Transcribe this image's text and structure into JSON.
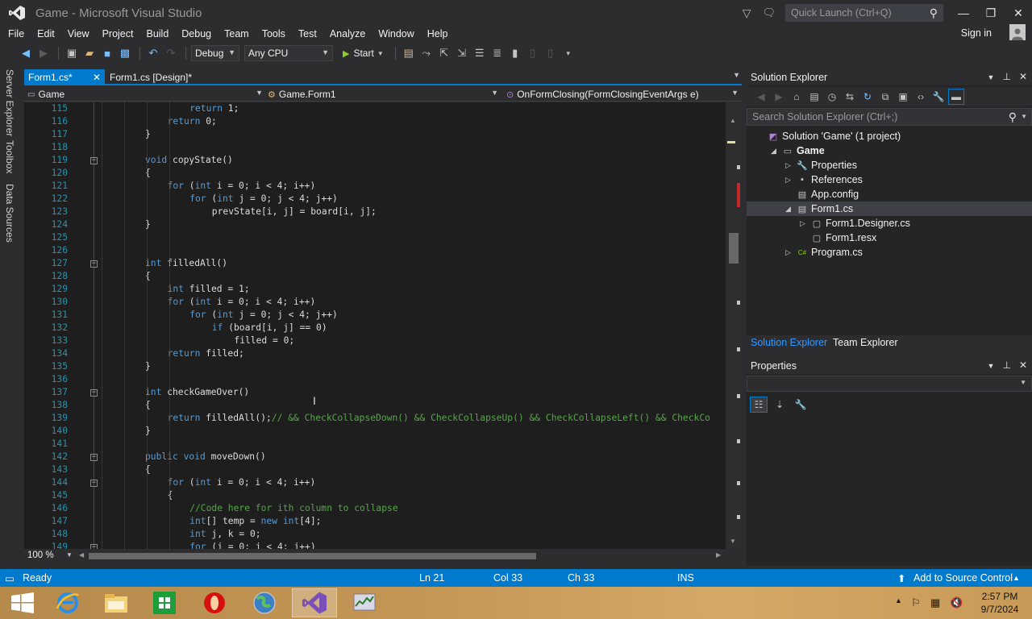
{
  "window": {
    "title": "Game - Microsoft Visual Studio",
    "quick_launch_placeholder": "Quick Launch (Ctrl+Q)",
    "sign_in": "Sign in"
  },
  "menu": [
    "File",
    "Edit",
    "View",
    "Project",
    "Build",
    "Debug",
    "Team",
    "Tools",
    "Test",
    "Analyze",
    "Window",
    "Help"
  ],
  "toolbar": {
    "config": "Debug",
    "platform": "Any CPU",
    "start_label": "Start"
  },
  "side_tabs": [
    "Server Explorer",
    "Toolbox",
    "Data Sources"
  ],
  "doc_tabs": {
    "active": "Form1.cs*",
    "inactive": "Form1.cs [Design]*"
  },
  "nav": {
    "project": "Game",
    "class": "Game.Form1",
    "member": "OnFormClosing(FormClosingEventArgs e)"
  },
  "code_lines": [
    {
      "n": "115",
      "indent": 3,
      "code": "<span class='kw'>return</span> 1;"
    },
    {
      "n": "116",
      "indent": 2,
      "code": "<span class='kw'>return</span> 0;"
    },
    {
      "n": "117",
      "indent": 1,
      "code": "}"
    },
    {
      "n": "118",
      "indent": 0,
      "code": ""
    },
    {
      "n": "119",
      "indent": 1,
      "fold": true,
      "code": "<span class='kw'>void</span> copyState()"
    },
    {
      "n": "120",
      "indent": 1,
      "code": "{"
    },
    {
      "n": "121",
      "indent": 2,
      "code": "<span class='kw'>for</span> (<span class='kw'>int</span> i = 0; i &lt; 4; i++)"
    },
    {
      "n": "122",
      "indent": 3,
      "code": "<span class='kw'>for</span> (<span class='kw'>int</span> j = 0; j &lt; 4; j++)"
    },
    {
      "n": "123",
      "indent": 4,
      "code": "prevState[i, j] = board[i, j];"
    },
    {
      "n": "124",
      "indent": 1,
      "code": "}"
    },
    {
      "n": "125",
      "indent": 0,
      "code": ""
    },
    {
      "n": "126",
      "indent": 0,
      "code": ""
    },
    {
      "n": "127",
      "indent": 1,
      "fold": true,
      "code": "<span class='kw'>int</span> filledAll()"
    },
    {
      "n": "128",
      "indent": 1,
      "code": "{"
    },
    {
      "n": "129",
      "indent": 2,
      "code": "<span class='kw'>int</span> filled = 1;"
    },
    {
      "n": "130",
      "indent": 2,
      "code": "<span class='kw'>for</span> (<span class='kw'>int</span> i = 0; i &lt; 4; i++)"
    },
    {
      "n": "131",
      "indent": 3,
      "code": "<span class='kw'>for</span> (<span class='kw'>int</span> j = 0; j &lt; 4; j++)"
    },
    {
      "n": "132",
      "indent": 4,
      "code": "<span class='kw'>if</span> (board[i, j] == 0)"
    },
    {
      "n": "133",
      "indent": 5,
      "code": "filled = 0;"
    },
    {
      "n": "134",
      "indent": 2,
      "code": "<span class='kw'>return</span> filled;"
    },
    {
      "n": "135",
      "indent": 1,
      "code": "}"
    },
    {
      "n": "136",
      "indent": 0,
      "code": ""
    },
    {
      "n": "137",
      "indent": 1,
      "fold": true,
      "code": "<span class='kw'>int</span> checkGameOver()"
    },
    {
      "n": "138",
      "indent": 1,
      "code": "{"
    },
    {
      "n": "139",
      "indent": 2,
      "code": "<span class='kw'>return</span> filledAll();<span class='cm'>// &amp;&amp; CheckCollapseDown() &amp;&amp; CheckCollapseUp() &amp;&amp; CheckCollapseLeft() &amp;&amp; CheckCo</span>"
    },
    {
      "n": "140",
      "indent": 1,
      "code": "}"
    },
    {
      "n": "141",
      "indent": 0,
      "code": ""
    },
    {
      "n": "142",
      "indent": 1,
      "fold": true,
      "code": "<span class='kw'>public</span> <span class='kw'>void</span> moveDown()"
    },
    {
      "n": "143",
      "indent": 1,
      "code": "{"
    },
    {
      "n": "144",
      "indent": 2,
      "fold": true,
      "code": "<span class='kw'>for</span> (<span class='kw'>int</span> i = 0; i &lt; 4; i++)"
    },
    {
      "n": "145",
      "indent": 2,
      "code": "{"
    },
    {
      "n": "146",
      "indent": 3,
      "code": "<span class='cm'>//Code here for ith column to collapse</span>"
    },
    {
      "n": "147",
      "indent": 3,
      "code": "<span class='kw'>int</span>[] temp = <span class='kw'>new</span> <span class='kw'>int</span>[4];"
    },
    {
      "n": "148",
      "indent": 3,
      "code": "<span class='kw'>int</span> j, k = 0;"
    },
    {
      "n": "149",
      "indent": 3,
      "fold": true,
      "code": "<span class='kw'>for</span> (j = 0; j &lt; 4; j++)"
    }
  ],
  "zoom": "100 %",
  "solution_explorer": {
    "title": "Solution Explorer",
    "search_placeholder": "Search Solution Explorer (Ctrl+;)",
    "tree": [
      {
        "label": "Solution 'Game' (1 project)",
        "icon": "solution-icon",
        "level": 0,
        "twisty": "",
        "bold": false
      },
      {
        "label": "Game",
        "icon": "csharp-project-icon",
        "level": 1,
        "twisty": "open",
        "bold": true
      },
      {
        "label": "Properties",
        "icon": "wrench-icon",
        "level": 2,
        "twisty": "closed",
        "bold": false
      },
      {
        "label": "References",
        "icon": "references-icon",
        "level": 2,
        "twisty": "closed",
        "bold": false
      },
      {
        "label": "App.config",
        "icon": "config-icon",
        "level": 2,
        "twisty": "",
        "bold": false
      },
      {
        "label": "Form1.cs",
        "icon": "form-icon",
        "level": 2,
        "twisty": "open",
        "bold": false,
        "selected": true
      },
      {
        "label": "Form1.Designer.cs",
        "icon": "cs-file-icon",
        "level": 3,
        "twisty": "closed",
        "bold": false
      },
      {
        "label": "Form1.resx",
        "icon": "resx-icon",
        "level": 3,
        "twisty": "",
        "bold": false
      },
      {
        "label": "Program.cs",
        "icon": "csharp-file-icon",
        "level": 2,
        "twisty": "closed",
        "bold": false
      }
    ],
    "tabs": [
      "Solution Explorer",
      "Team Explorer"
    ]
  },
  "properties": {
    "title": "Properties"
  },
  "status": {
    "ready": "Ready",
    "ln": "Ln 21",
    "col": "Col 33",
    "ch": "Ch 33",
    "ins": "INS",
    "source_control": "Add to Source Control"
  },
  "clock": {
    "time": "2:57 PM",
    "date": "9/7/2024"
  },
  "colors": {
    "accent": "#007acc",
    "editor_bg": "#1e1e1e",
    "keyword": "#569cd6",
    "comment": "#57a64a",
    "line_number": "#2b91af"
  }
}
